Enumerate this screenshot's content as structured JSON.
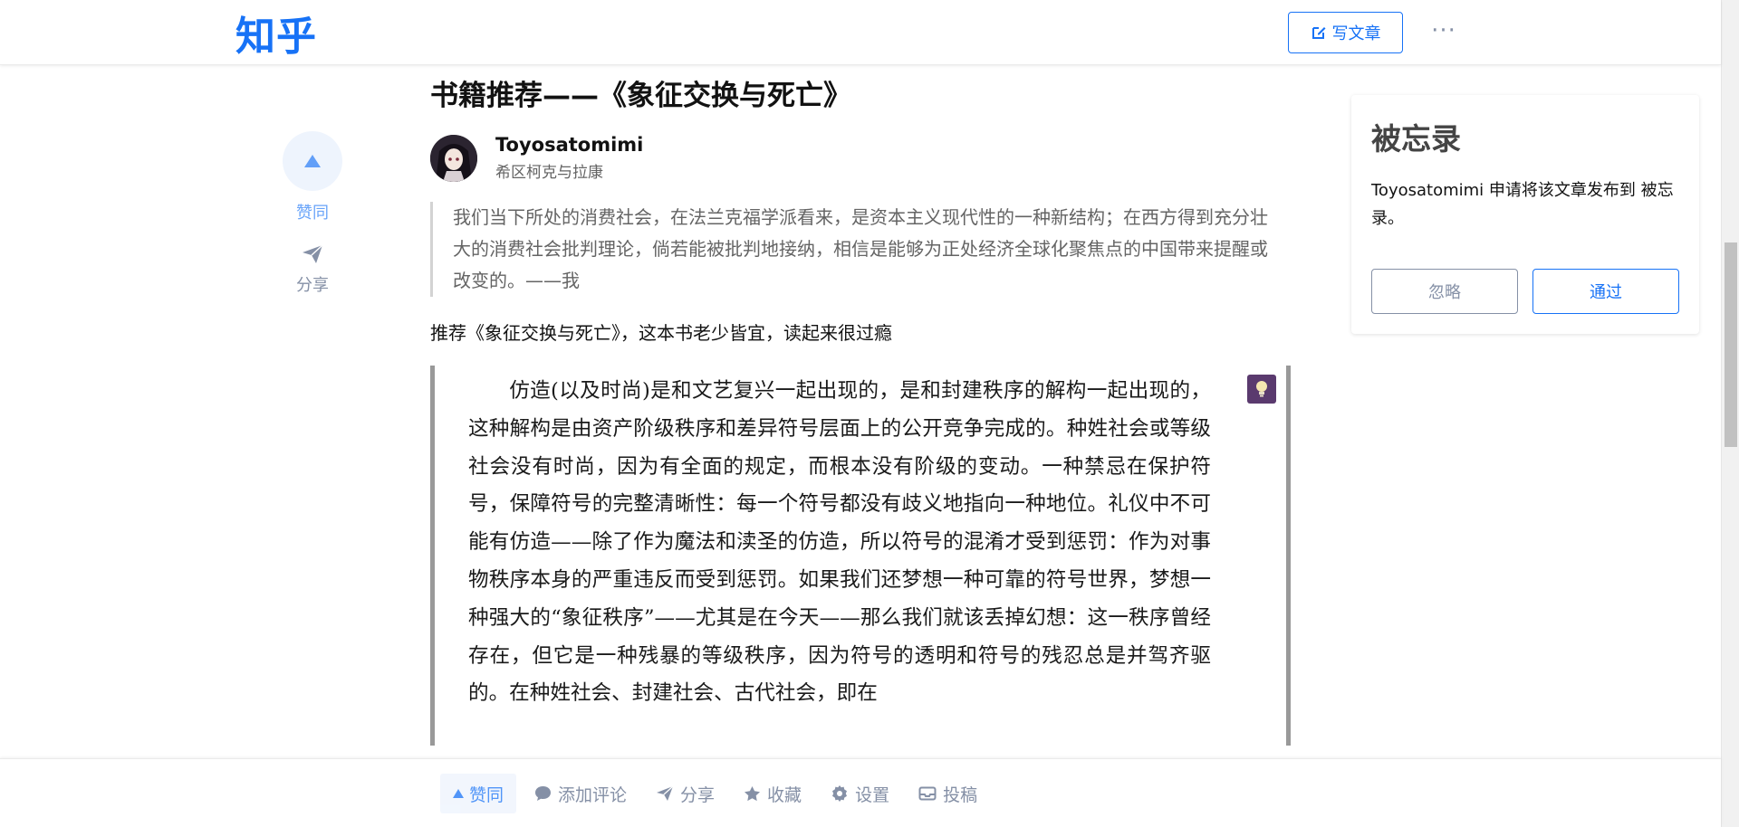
{
  "header": {
    "logo": "知乎",
    "write_button": "写文章",
    "more": "···"
  },
  "side": {
    "vote_label": "赞同",
    "share_label": "分享"
  },
  "article": {
    "title": "书籍推荐——《象征交换与死亡》",
    "author_name": "Toyosatomimi",
    "author_bio": "希区柯克与拉康",
    "quote": "我们当下所处的消费社会，在法兰克福学派看来，是资本主义现代性的一种新结构；在西方得到充分壮大的消费社会批判理论，倘若能被批判地接纳，相信是能够为正处经济全球化聚焦点的中国带来提醒或改变的。——我",
    "paragraph": "推荐《象征交换与死亡》，这本书老少皆宜，读起来很过瘾",
    "book_excerpt": "仿造(以及时尚)是和文艺复兴一起出现的，是和封建秩序的解构一起出现的，这种解构是由资产阶级秩序和差异符号层面上的公开竞争完成的。种姓社会或等级社会没有时尚，因为有全面的规定，而根本没有阶级的变动。一种禁忌在保护符号，保障符号的完整清晰性：每一个符号都没有歧义地指向一种地位。礼仪中不可能有仿造——除了作为魔法和渎圣的仿造，所以符号的混淆才受到惩罚：作为对事物秩序本身的严重违反而受到惩罚。如果我们还梦想一种可靠的符号世界，梦想一种强大的“象征秩序”——尤其是在今天——那么我们就该丢掉幻想：这一秩序曾经存在，但它是一种残暴的等级秩序，因为符号的透明和符号的残忍总是并驾齐驱的。在种姓社会、封建社会、古代社会，即在"
  },
  "card": {
    "title": "被忘录",
    "text": "Toyosatomimi 申请将该文章发布到 被忘录。",
    "ignore_button": "忽略",
    "approve_button": "通过"
  },
  "bottom_bar": {
    "vote": "赞同",
    "comment": "添加评论",
    "share": "分享",
    "favorite": "收藏",
    "settings": "设置",
    "submit": "投稿"
  },
  "colors": {
    "brand": "#1772f6",
    "muted": "#8590a6"
  }
}
